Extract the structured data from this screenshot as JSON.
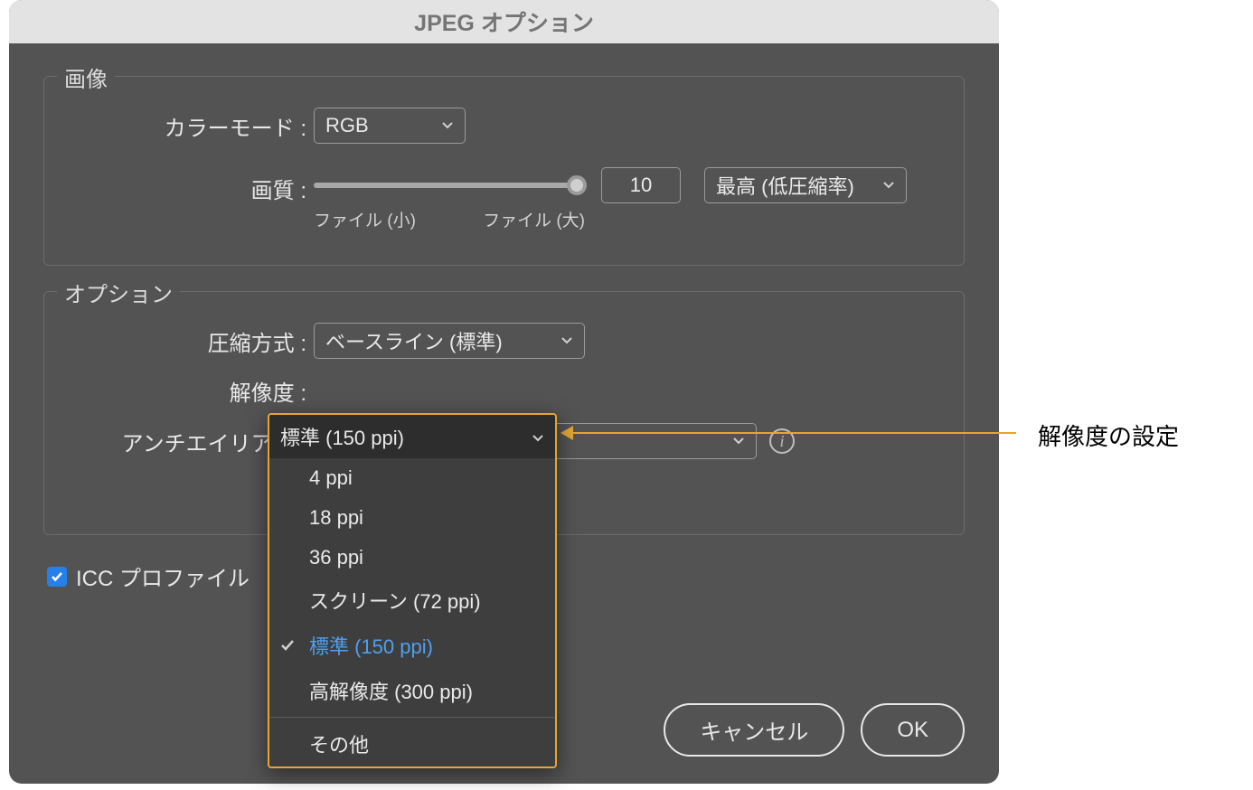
{
  "dialog": {
    "title": "JPEG オプション"
  },
  "image_group": {
    "legend": "画像",
    "color_mode_label": "カラーモード :",
    "color_mode_value": "RGB",
    "quality_label": "画質 :",
    "quality_value": "10",
    "quality_preset": "最高 (低圧縮率)",
    "slider_min_label": "ファイル (小)",
    "slider_max_label": "ファイル (大)"
  },
  "options_group": {
    "legend": "オプション",
    "compression_label": "圧縮方式 :",
    "compression_value": "ベースライン (標準)",
    "resolution_label": "解像度 :",
    "resolution_value": "標準 (150 ppi)",
    "antialias_label": "アンチエイリアス :",
    "antialias_value": ""
  },
  "resolution_menu": {
    "current": "標準 (150 ppi)",
    "items": [
      {
        "label": "4 ppi",
        "selected": false
      },
      {
        "label": "18 ppi",
        "selected": false
      },
      {
        "label": "36 ppi",
        "selected": false
      },
      {
        "label": "スクリーン (72 ppi)",
        "selected": false
      },
      {
        "label": "標準 (150 ppi)",
        "selected": true
      },
      {
        "label": "高解像度 (300 ppi)",
        "selected": false
      }
    ],
    "other": "その他"
  },
  "icc": {
    "checkbox_label": "ICC プロファイル",
    "checked": true
  },
  "buttons": {
    "cancel": "キャンセル",
    "ok": "OK"
  },
  "callout": {
    "text": "解像度の設定"
  }
}
